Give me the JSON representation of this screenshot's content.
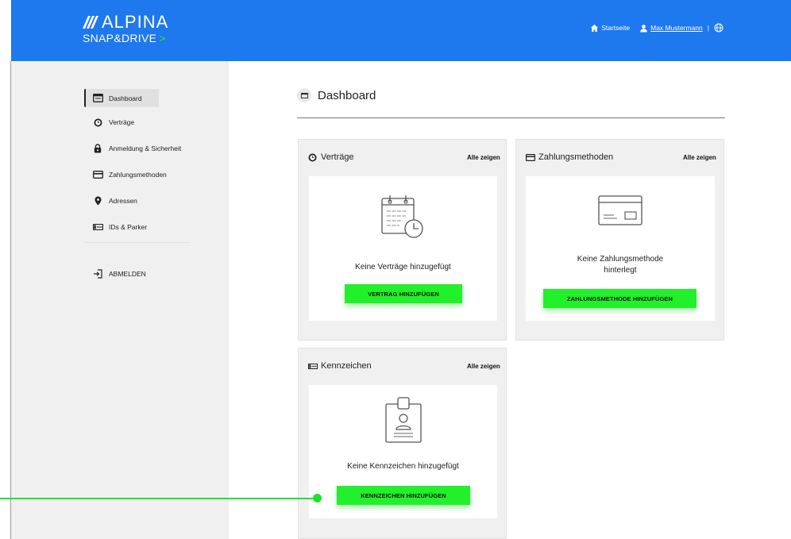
{
  "header": {
    "brand_top": "ALPINA",
    "brand_bottom": "SNAP&DRIVE",
    "brand_chevron": ">",
    "home_link": "Startseite",
    "user_link": "Max Mustermann",
    "separator": "|",
    "home_icon": "home-icon",
    "user_icon": "user-icon",
    "language_icon": "globe-icon",
    "color": "#1e78ee"
  },
  "sidebar": {
    "items": [
      {
        "label": "Dashboard",
        "icon": "dashboard-icon",
        "active": true
      },
      {
        "label": "Verträge",
        "icon": "clock-icon"
      },
      {
        "label": "Anmeldung & Sicherheit",
        "icon": "lock-icon"
      },
      {
        "label": "Zahlungsmethoden",
        "icon": "credit-card-icon"
      },
      {
        "label": "Adressen",
        "icon": "location-pin-icon"
      },
      {
        "label": "IDs & Parker",
        "icon": "license-plate-icon"
      }
    ],
    "logout": {
      "label": "ABMELDEN",
      "icon": "logout-icon"
    }
  },
  "main": {
    "title": "Dashboard",
    "cards": {
      "contracts": {
        "title": "Verträge",
        "link": "Alle zeigen",
        "empty": "Keine Verträge hinzugefügt",
        "button": "VERTRAG HINZUFÜGEN",
        "illustration": "calendar-clock-icon"
      },
      "payment": {
        "title": "Zahlungsmethoden",
        "link": "Alle zeigen",
        "empty_line1": "Keine Zahlungsmethode",
        "empty_line2": "hinterlegt",
        "button": "ZAHLUNGSMETHODE HINZUFÜGEN",
        "illustration": "credit-card-icon"
      },
      "plates": {
        "title": "Kennzeichen",
        "link": "Alle zeigen",
        "empty": "Keine Kennzeichen hinzugefügt",
        "button": "KENNZEICHEN HINZUFÜGEN",
        "illustration": "id-badge-icon"
      }
    }
  },
  "accent_color": "#22f02a"
}
